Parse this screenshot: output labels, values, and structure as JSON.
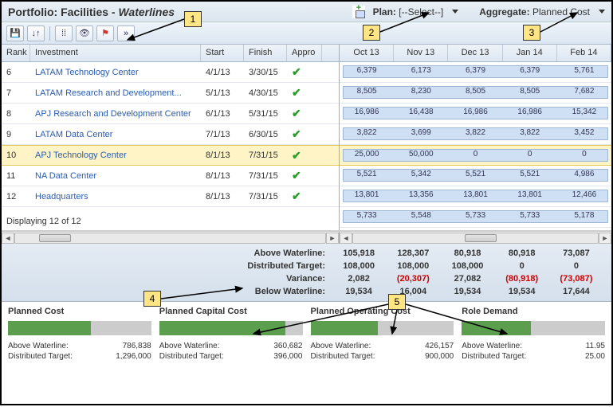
{
  "header": {
    "title_prefix": "Portfolio: Facilities - ",
    "title_italic": "Waterlines",
    "plan_label": "Plan:",
    "plan_value": "[--Select--]",
    "agg_label": "Aggregate:",
    "agg_value": "Planned Cost"
  },
  "columns": {
    "rank": "Rank",
    "investment": "Investment",
    "start": "Start",
    "finish": "Finish",
    "approved": "Appro"
  },
  "months": [
    "Oct 13",
    "Nov 13",
    "Dec 13",
    "Jan 14",
    "Feb 14"
  ],
  "rows": [
    {
      "rank": "6",
      "inv": "LATAM Technology Center",
      "start": "4/1/13",
      "fin": "3/30/15",
      "appr": true,
      "hl": false,
      "vals": [
        "6,379",
        "6,173",
        "6,379",
        "6,379",
        "5,761"
      ]
    },
    {
      "rank": "7",
      "inv": "LATAM Research and Development...",
      "start": "5/1/13",
      "fin": "4/30/15",
      "appr": true,
      "hl": false,
      "vals": [
        "8,505",
        "8,230",
        "8,505",
        "8,505",
        "7,682"
      ]
    },
    {
      "rank": "8",
      "inv": "APJ Research and Development Center",
      "start": "6/1/13",
      "fin": "5/31/15",
      "appr": true,
      "hl": false,
      "vals": [
        "16,986",
        "16,438",
        "16,986",
        "16,986",
        "15,342"
      ]
    },
    {
      "rank": "9",
      "inv": "LATAM Data Center",
      "start": "7/1/13",
      "fin": "6/30/15",
      "appr": true,
      "hl": false,
      "vals": [
        "3,822",
        "3,699",
        "3,822",
        "3,822",
        "3,452"
      ]
    },
    {
      "rank": "10",
      "inv": "APJ Technology Center",
      "start": "8/1/13",
      "fin": "7/31/15",
      "appr": true,
      "hl": true,
      "vals": [
        "25,000",
        "50,000",
        "0",
        "0",
        "0"
      ]
    },
    {
      "rank": "11",
      "inv": "NA Data Center",
      "start": "8/1/13",
      "fin": "7/31/15",
      "appr": true,
      "hl": false,
      "vals": [
        "5,521",
        "5,342",
        "5,521",
        "5,521",
        "4,986"
      ]
    },
    {
      "rank": "12",
      "inv": "Headquarters",
      "start": "8/1/13",
      "fin": "7/31/15",
      "appr": true,
      "hl": false,
      "vals": [
        "13,801",
        "13,356",
        "13,801",
        "13,801",
        "12,466"
      ]
    },
    {
      "rank": "",
      "inv": "",
      "start": "",
      "fin": "",
      "appr": false,
      "hl": false,
      "vals": [
        "5,733",
        "5,548",
        "5,733",
        "5,733",
        "5,178"
      ]
    }
  ],
  "displaying": "Displaying 12 of 12",
  "summary": {
    "labels": [
      "Above Waterline:",
      "Distributed Target:",
      "Variance:",
      "Below Waterline:"
    ],
    "rows": [
      [
        "105,918",
        "128,307",
        "80,918",
        "80,918",
        "73,087"
      ],
      [
        "108,000",
        "108,000",
        "108,000",
        "0",
        "0"
      ],
      [
        "2,082",
        "(20,307)",
        "27,082",
        "(80,918)",
        "(73,087)"
      ],
      [
        "19,534",
        "16,004",
        "19,534",
        "19,534",
        "17,644"
      ]
    ],
    "neg": [
      [],
      [],
      [
        1,
        3,
        4
      ],
      []
    ]
  },
  "metrics": [
    {
      "title": "Planned Cost",
      "fill": 58,
      "above": "786,838",
      "target": "1,296,000"
    },
    {
      "title": "Planned Capital Cost",
      "fill": 88,
      "above": "360,682",
      "target": "396,000"
    },
    {
      "title": "Planned Operating Cost",
      "fill": 47,
      "above": "426,157",
      "target": "900,000"
    },
    {
      "title": "Role Demand",
      "fill": 48,
      "above": "11.95",
      "target": "25.00"
    }
  ],
  "metric_labels": {
    "above": "Above Waterline:",
    "target": "Distributed Target:"
  },
  "callouts": {
    "1": "1",
    "2": "2",
    "3": "3",
    "4": "4",
    "5": "5"
  }
}
